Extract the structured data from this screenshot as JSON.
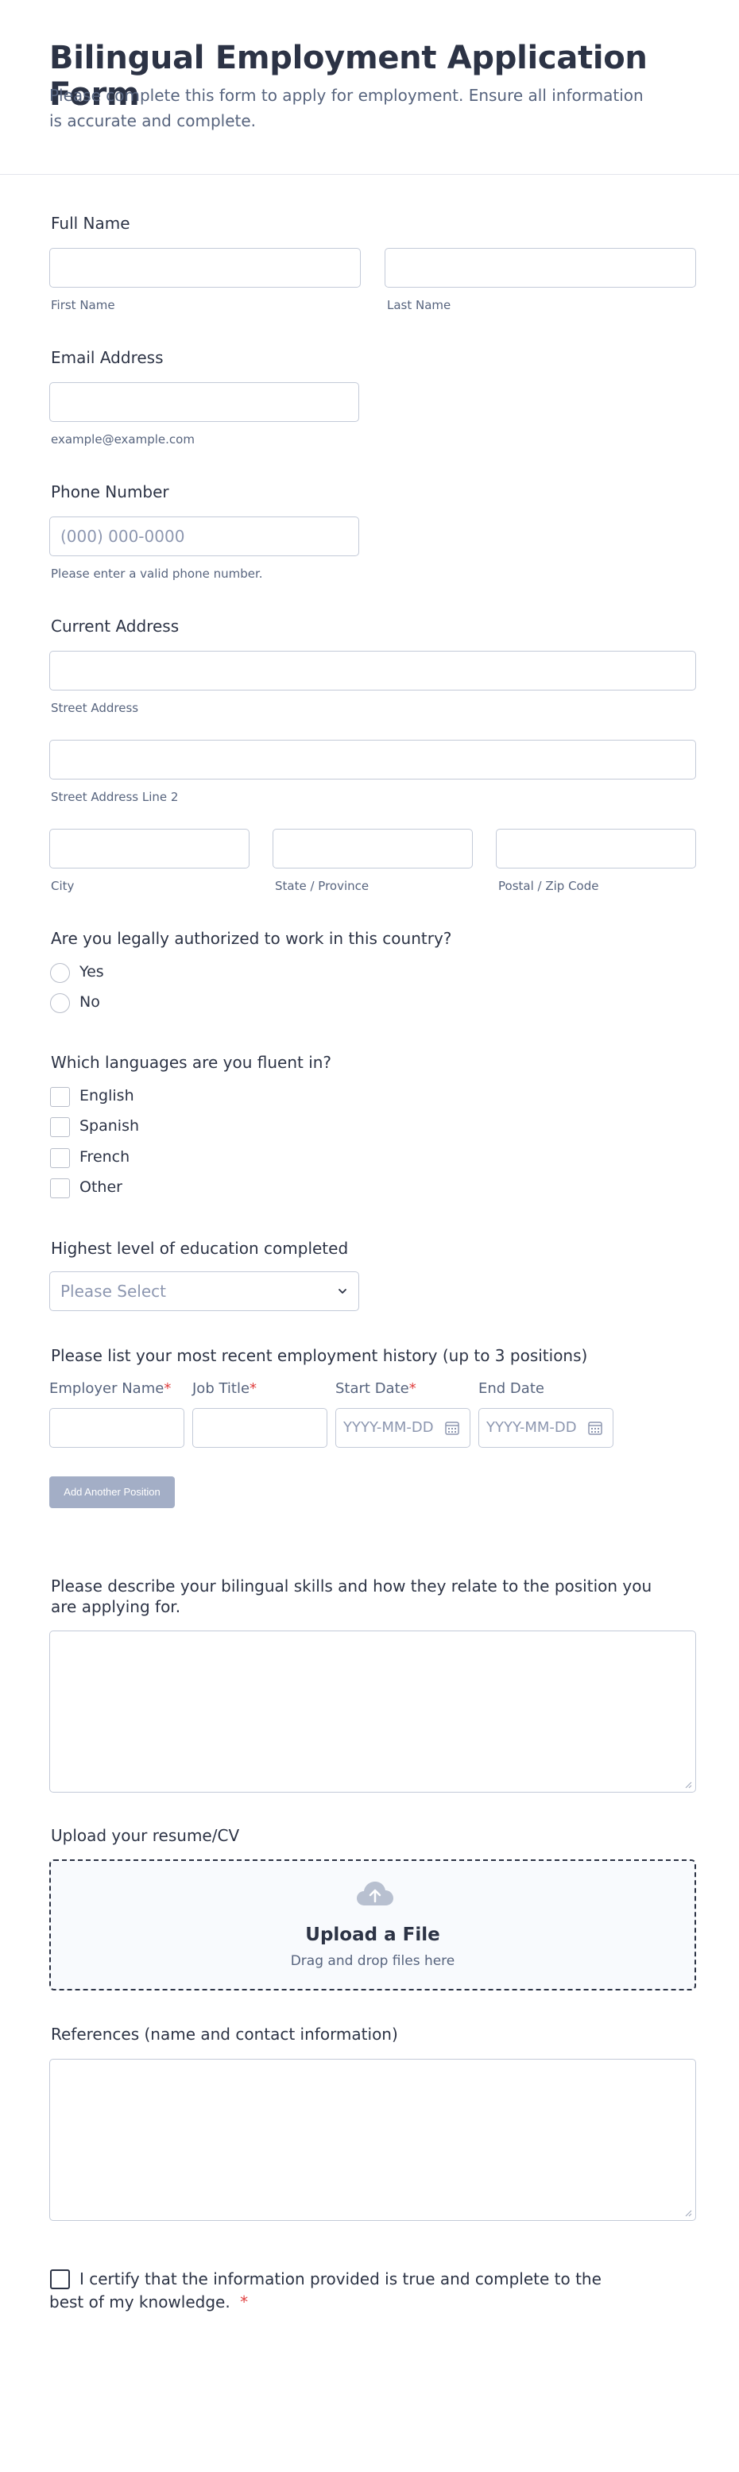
{
  "header": {
    "title": "Bilingual Employment Application Form",
    "description": "Please complete this form to apply for employment. Ensure all information is accurate and complete."
  },
  "full_name": {
    "label": "Full Name",
    "first_sublabel": "First Name",
    "last_sublabel": "Last Name"
  },
  "email": {
    "label": "Email Address",
    "sublabel": "example@example.com"
  },
  "phone": {
    "label": "Phone Number",
    "placeholder": "(000) 000-0000",
    "sublabel": "Please enter a valid phone number."
  },
  "address": {
    "label": "Current Address",
    "street_sublabel": "Street Address",
    "street2_sublabel": "Street Address Line 2",
    "city_sublabel": "City",
    "state_sublabel": "State / Province",
    "zip_sublabel": "Postal / Zip Code"
  },
  "authorized": {
    "label": "Are you legally authorized to work in this country?",
    "options": [
      "Yes",
      "No"
    ]
  },
  "languages": {
    "label": "Which languages are you fluent in?",
    "options": [
      "English",
      "Spanish",
      "French",
      "Other"
    ]
  },
  "education": {
    "label": "Highest level of education completed",
    "selected": "Please Select"
  },
  "employment": {
    "label": "Please list your most recent employment history (up to 3 positions)",
    "columns": [
      "Employer Name",
      "Job Title",
      "Start Date",
      "End Date"
    ],
    "required_marker": "*",
    "date_placeholder": "YYYY-MM-DD",
    "add_button": "Add Another Position"
  },
  "bilingual_skills": {
    "label": "Please describe your bilingual skills and how they relate to the position you are applying for."
  },
  "resume": {
    "label": "Upload your resume/CV",
    "upload_title": "Upload a File",
    "upload_sub": "Drag and drop files here"
  },
  "references": {
    "label": "References (name and contact information)"
  },
  "certify": {
    "text": "I certify that the information provided is true and complete to the best of my knowledge.",
    "required_marker": "*"
  },
  "colors": {
    "text": "#2c3345",
    "muted": "#57647e",
    "border": "#c3cad8",
    "button": "#a3aec6",
    "required": "#e03f3f"
  },
  "icons": [
    "chevron-down-icon",
    "calendar-icon",
    "cloud-upload-icon",
    "resize-handle-icon"
  ]
}
